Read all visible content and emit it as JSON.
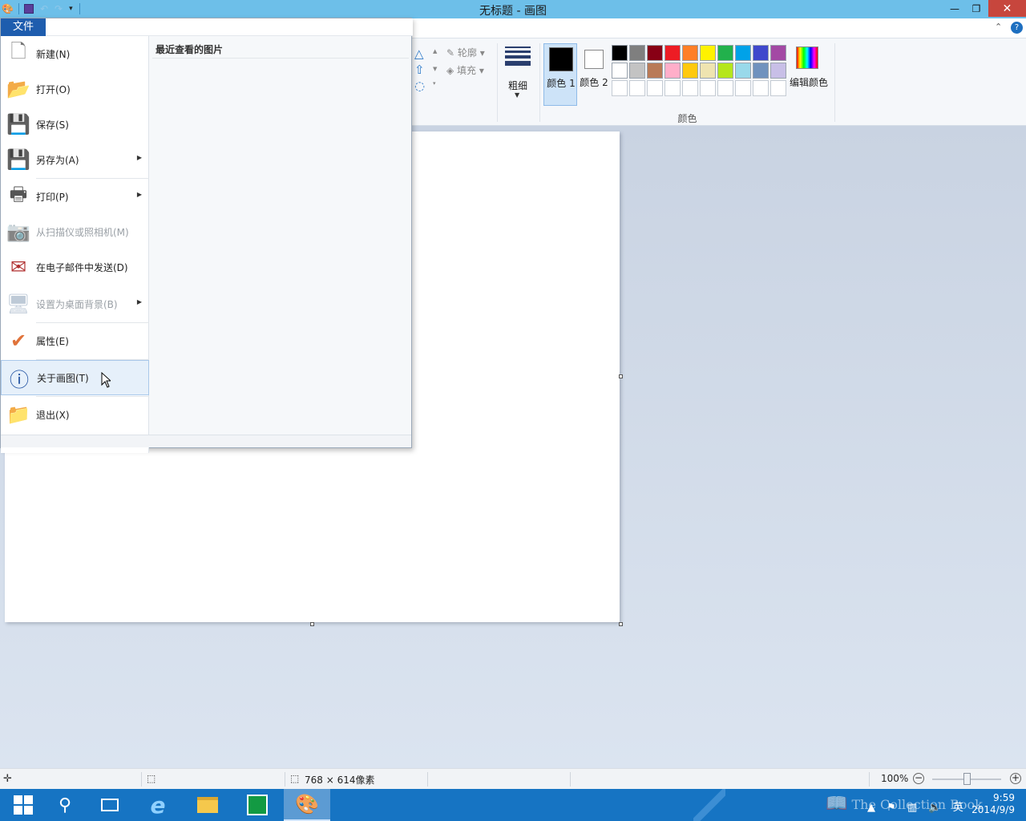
{
  "window": {
    "title": "无标题 - 画图",
    "controls": {
      "minimize": "—",
      "restore": "❐",
      "close": "✕"
    }
  },
  "ribbon": {
    "file_tab": "文件",
    "shapes": {
      "outline_label": "轮廓",
      "fill_label": "填充"
    },
    "size_label": "粗细",
    "color1_label": "颜色 1",
    "color2_label": "颜色 2",
    "edit_colors_label": "编辑颜色",
    "colors_group_label": "颜色",
    "palette": [
      [
        "#000000",
        "#7f7f7f",
        "#880015",
        "#ed1c24",
        "#ff7f27",
        "#fff200",
        "#22b14c",
        "#00a2e8",
        "#3f48cc",
        "#a349a4"
      ],
      [
        "#ffffff",
        "#c3c3c3",
        "#b97a57",
        "#ffaec9",
        "#ffc90e",
        "#efe4b0",
        "#b5e61d",
        "#99d9ea",
        "#7092be",
        "#c8bfe7"
      ],
      [
        "#ffffff",
        "#ffffff",
        "#ffffff",
        "#ffffff",
        "#ffffff",
        "#ffffff",
        "#ffffff",
        "#ffffff",
        "#ffffff",
        "#ffffff"
      ]
    ]
  },
  "file_menu": {
    "tab_label": "文件",
    "recent_title": "最近查看的图片",
    "items": [
      {
        "label": "新建(N)",
        "icon": "new-file-icon"
      },
      {
        "label": "打开(O)",
        "icon": "open-folder-icon"
      },
      {
        "label": "保存(S)",
        "icon": "save-icon"
      },
      {
        "label": "另存为(A)",
        "icon": "save-as-icon"
      },
      {
        "label": "打印(P)",
        "icon": "printer-icon"
      },
      {
        "label": "从扫描仪或照相机(M)",
        "icon": "scanner-icon"
      },
      {
        "label": "在电子邮件中发送(D)",
        "icon": "email-icon"
      },
      {
        "label": "设置为桌面背景(B)",
        "icon": "desktop-background-icon"
      },
      {
        "label": "属性(E)",
        "icon": "properties-check-icon"
      },
      {
        "label": "关于画图(T)",
        "icon": "info-icon"
      },
      {
        "label": "退出(X)",
        "icon": "exit-icon"
      }
    ]
  },
  "statusbar": {
    "dimensions": "768 × 614像素",
    "zoom": "100%"
  },
  "taskbar": {
    "time": "9:59",
    "date": "2014/9/9",
    "ime": "英",
    "watermark": "The Collection Book"
  }
}
